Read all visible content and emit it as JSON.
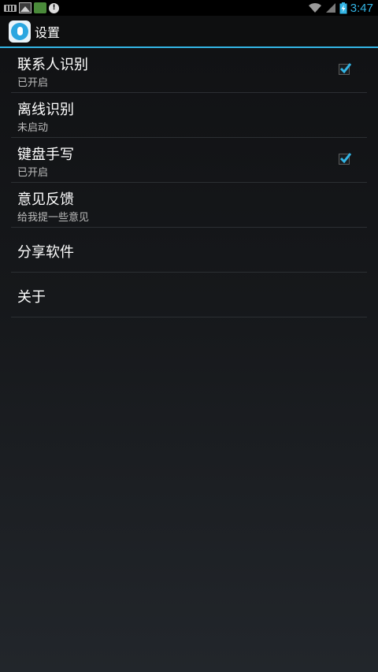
{
  "status_bar": {
    "time": "3:47",
    "left_icons": [
      "keyboard-icon",
      "image-icon",
      "app-green-icon",
      "shield-icon"
    ],
    "right_icons": [
      "wifi-icon",
      "signal-icon",
      "battery-charging-icon"
    ],
    "accent_color": "#33b5e5"
  },
  "action_bar": {
    "title": "设置",
    "app_icon": "voice-input-app-icon"
  },
  "settings": [
    {
      "title": "联系人识别",
      "subtitle": "已开启",
      "checked": true
    },
    {
      "title": "离线识别",
      "subtitle": "未启动",
      "checked": false
    },
    {
      "title": "键盘手写",
      "subtitle": "已开启",
      "checked": true
    },
    {
      "title": "意见反馈",
      "subtitle": "给我提一些意见"
    },
    {
      "title": "分享软件"
    },
    {
      "title": "关于"
    }
  ]
}
